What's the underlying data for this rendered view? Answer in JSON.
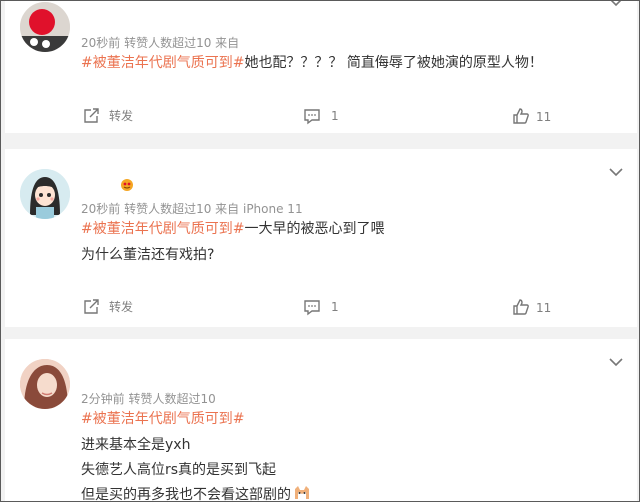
{
  "comments": [
    {
      "meta": "20秒前 转赞人数超过10 来自",
      "tag": "#被董洁年代剧气质可到#",
      "text1": "她也配？？？？ 简直侮辱了被她演的原型人物！",
      "share_label": "转发",
      "comment_count": "1",
      "like_count": "11",
      "avatar_icon": "red-avatar"
    },
    {
      "meta": "20秒前 转赞人数超过10 来自 iPhone 11",
      "tag": "#被董洁年代剧气质可到#",
      "text1": "一大早的被恶心到了喂",
      "text2": "为什么董洁还有戏拍?",
      "share_label": "转发",
      "comment_count": "1",
      "like_count": "11",
      "avatar_icon": "cartoon-girl-avatar"
    },
    {
      "meta": "2分钟前 转赞人数超过10",
      "tag": "#被董洁年代剧气质可到#",
      "text1": "进来基本全是yxh",
      "text2": "失德艺人高位rs真的是买到飞起",
      "text3": "但是买的再多我也不会看这部剧的",
      "avatar_icon": "photo-avatar"
    }
  ]
}
